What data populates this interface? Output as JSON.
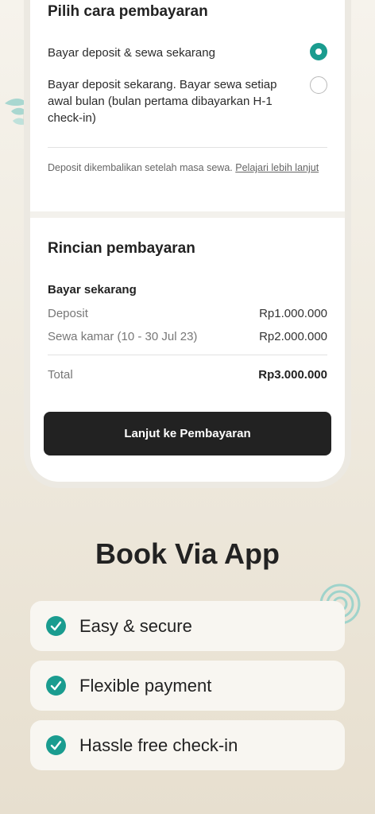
{
  "payment_method": {
    "title": "Pilih cara pembayaran",
    "options": [
      {
        "label": "Bayar deposit & sewa sekarang",
        "selected": true
      },
      {
        "label": "Bayar deposit sekarang. Bayar sewa setiap awal bulan (bulan pertama dibayarkan H-1 check-in)",
        "selected": false
      }
    ],
    "note": "Deposit dikembalikan setelah masa sewa.",
    "note_link": "Pelajari lebih lanjut"
  },
  "payment_details": {
    "title": "Rincian pembayaran",
    "section_label": "Bayar sekarang",
    "rows": [
      {
        "label": "Deposit",
        "value": "Rp1.000.000"
      },
      {
        "label": "Sewa kamar (10 - 30 Jul 23)",
        "value": "Rp2.000.000"
      }
    ],
    "total_label": "Total",
    "total_value": "Rp3.000.000"
  },
  "cta_label": "Lanjut ke Pembayaran",
  "promo": {
    "heading": "Book Via App",
    "features": [
      "Easy & secure",
      "Flexible payment",
      "Hassle free check-in"
    ]
  },
  "colors": {
    "accent": "#1a9c8f",
    "cta": "#222222"
  }
}
